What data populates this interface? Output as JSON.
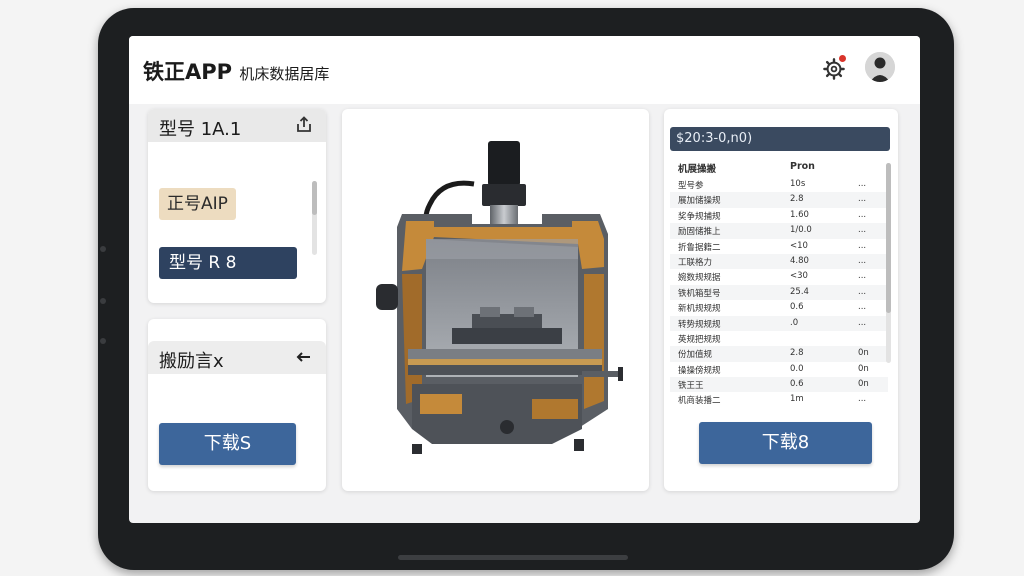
{
  "app": {
    "title": "铁正APP",
    "subtitle": "机床数据居库"
  },
  "left_card_top": {
    "header": "型号 1A.1",
    "chip_beige": "正号AIP",
    "chip_navy": "型号 R 8"
  },
  "left_card_bottom": {
    "header": "搬励言x",
    "download_label": "下载S"
  },
  "right_card": {
    "header": "$20:3-0,n0)",
    "columns": [
      "机展操搬",
      "Pron",
      ""
    ],
    "rows": [
      [
        "型号参",
        "10s",
        "..."
      ],
      [
        "展加储操规",
        "2.8",
        "..."
      ],
      [
        "奖争规捕规",
        "1.60",
        "..."
      ],
      [
        "励固储推上",
        "1/0.0",
        "..."
      ],
      [
        "折鲁据籍二",
        "<10",
        "..."
      ],
      [
        "工联格力",
        "4.80",
        "..."
      ],
      [
        "婉数规规据",
        "<30",
        "..."
      ],
      [
        "铁机箱型号",
        "25.4",
        "..."
      ],
      [
        "新机规规规",
        "0.6",
        "..."
      ],
      [
        "转势规规规",
        ".0",
        "..."
      ],
      [
        "英规把规规",
        "",
        ""
      ],
      [
        "份加值规",
        "2.8",
        "0n"
      ],
      [
        "操操傍规规",
        "0.0",
        "0n"
      ],
      [
        "铁王王",
        "0.6",
        "0n"
      ],
      [
        "机商装播二",
        "1m",
        "..."
      ]
    ],
    "download_label": "下载8"
  },
  "colors": {
    "accent": "#3d669b",
    "navy": "#2e4260",
    "beige": "#eddcc0"
  },
  "icons": [
    "gear-icon",
    "notification-dot",
    "avatar",
    "upload-icon",
    "back-arrow-icon"
  ]
}
